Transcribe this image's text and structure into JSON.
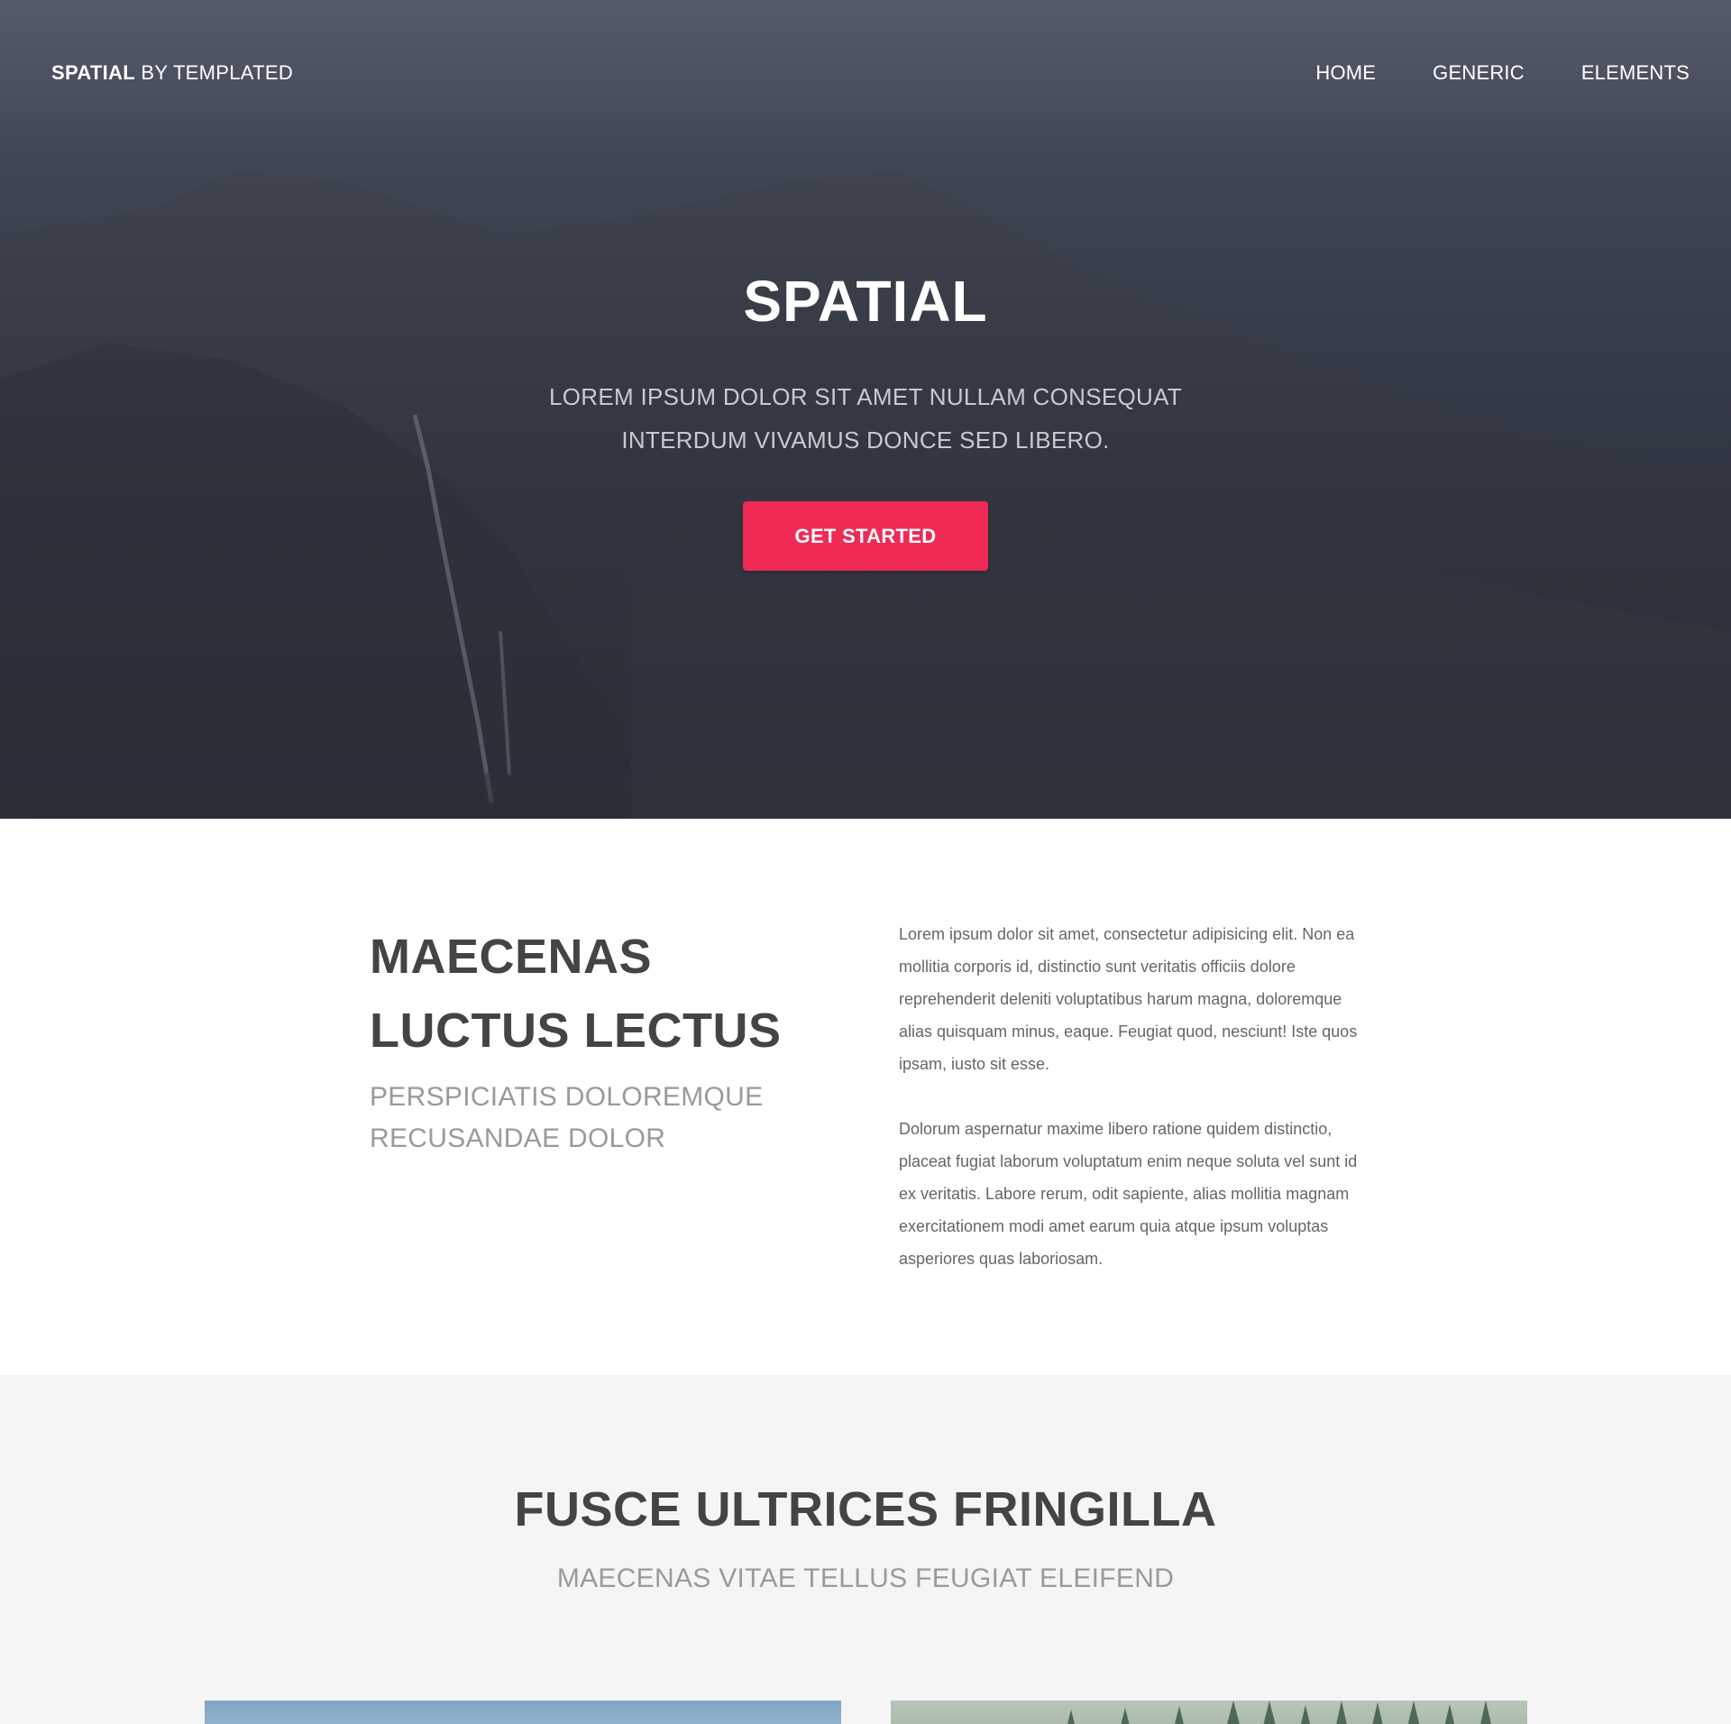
{
  "header": {
    "logo_strong": "SPATIAL",
    "logo_rest": "BY TEMPLATED",
    "nav": [
      {
        "label": "HOME"
      },
      {
        "label": "GENERIC"
      },
      {
        "label": "ELEMENTS"
      }
    ]
  },
  "hero": {
    "title": "SPATIAL",
    "subtitle_line1": "LOREM IPSUM DOLOR SIT AMET NULLAM CONSEQUAT",
    "subtitle_line2": "INTERDUM VIVAMUS DONCE SED LIBERO.",
    "cta_label": "GET STARTED"
  },
  "intro": {
    "heading_line1": "MAECENAS",
    "heading_line2": "LUCTUS LECTUS",
    "sub_line1": "PERSPICIATIS DOLOREMQUE",
    "sub_line2": "RECUSANDAE DOLOR",
    "paragraphs": [
      "Lorem ipsum dolor sit amet, consectetur adipisicing elit. Non ea mollitia corporis id, distinctio sunt veritatis officiis dolore reprehenderit deleniti voluptatibus harum magna, doloremque alias quisquam minus, eaque. Feugiat quod, nesciunt! Iste quos ipsam, iusto sit esse.",
      "Dolorum aspernatur maxime libero ratione quidem distinctio, placeat fugiat laborum voluptatum enim neque soluta vel sunt id ex veritatis. Labore rerum, odit sapiente, alias mollitia magnam exercitationem modi amet earum quia atque ipsum voluptas asperiores quas laboriosam."
    ]
  },
  "features": {
    "title": "FUSCE ULTRICES FRINGILLA",
    "subtitle": "MAECENAS VITAE TELLUS FEUGIAT ELEIFEND"
  },
  "colors": {
    "accent": "#ef2a55",
    "heading": "#444444",
    "muted": "#9a9a9a",
    "section_alt_bg": "#f5f5f5"
  }
}
